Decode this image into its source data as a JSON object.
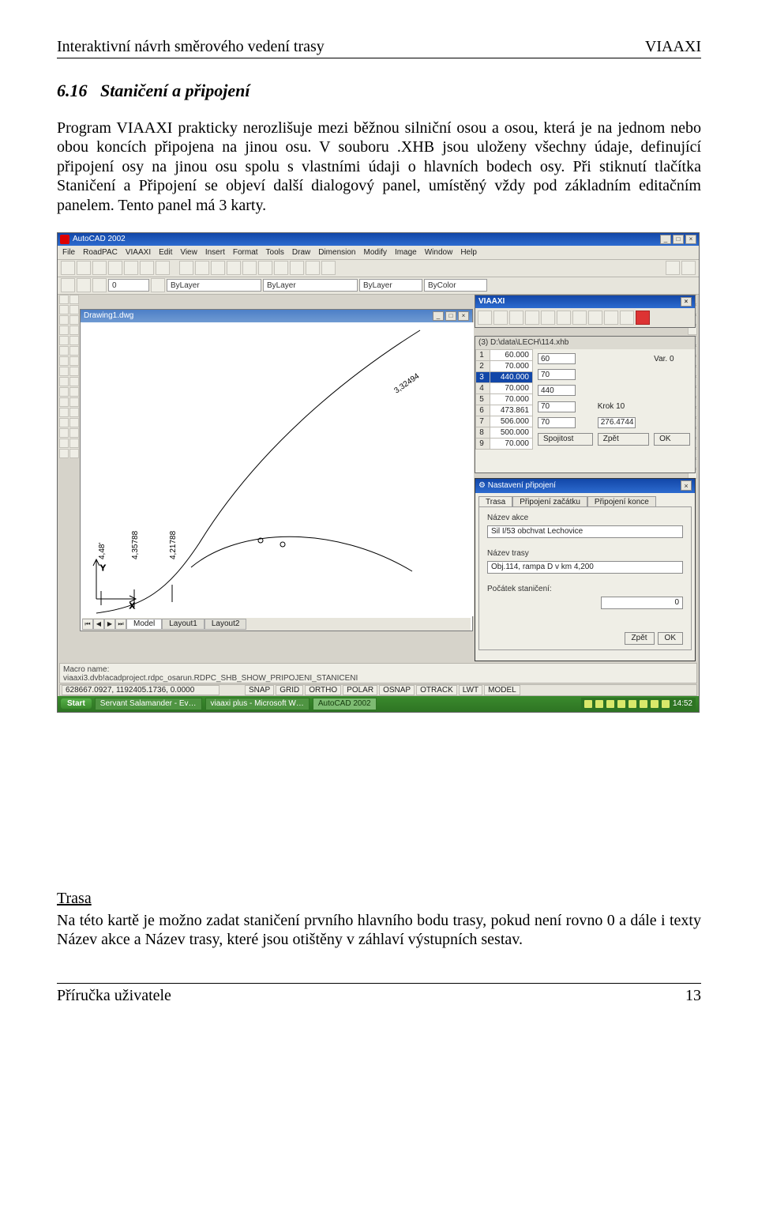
{
  "header": {
    "left": "Interaktivní návrh směrového vedení trasy",
    "right": "VIAAXI"
  },
  "section": {
    "num": "6.16",
    "title": "Staničení a připojení"
  },
  "para1": "Program VIAAXI prakticky nerozlišuje mezi běžnou silniční osou a osou, která je na jednom nebo obou koncích připojena na jinou osu. V souboru .XHB jsou uloženy všechny údaje, definující připojení osy na jinou osu spolu s vlastními údaji o hlavních bodech osy. Při stiknutí tlačítka Staničení a Připojení se objeví další dialogový panel, umístěný vždy pod základním editačním panelem. Tento panel má 3 karty.",
  "shot": {
    "app_title": "AutoCAD 2002",
    "menus": [
      "File",
      "RoadPAC",
      "VIAAXI",
      "Edit",
      "View",
      "Insert",
      "Format",
      "Tools",
      "Draw",
      "Dimension",
      "Modify",
      "Image",
      "Window",
      "Help"
    ],
    "layer_combo": "0",
    "bylayer": "ByLayer",
    "bycolor": "ByColor",
    "drawing_title": "Drawing1.dwg",
    "model_tabs": [
      "Model",
      "Layout1",
      "Layout2"
    ],
    "marks": {
      "a": "4,48'",
      "b": "4,35788",
      "c": "4,21788",
      "d": "3,32494"
    },
    "viaaxi_title": "VIAAXI",
    "axcard": {
      "title": "(3) D:\\data\\LECH\\114.xhb",
      "rows": [
        {
          "i": "1",
          "v": "60.000"
        },
        {
          "i": "2",
          "v": "70.000"
        },
        {
          "i": "3",
          "v": "440.000"
        },
        {
          "i": "4",
          "v": "70.000"
        },
        {
          "i": "5",
          "v": "70.000"
        },
        {
          "i": "6",
          "v": "473.861"
        },
        {
          "i": "7",
          "v": "506.000"
        },
        {
          "i": "8",
          "v": "500.000"
        },
        {
          "i": "9",
          "v": "70.000"
        }
      ],
      "r_fields": {
        "f1": "60",
        "f_var": "Var. 0",
        "f2": "70",
        "f3": "440",
        "f4": "70",
        "krok": "Krok 10",
        "f5": "70",
        "f6": "276.4744"
      },
      "r_btns": {
        "spoj": "Spojitost",
        "zp": "Zpět",
        "ok": "OK"
      }
    },
    "dialog": {
      "title": "Nastavení připojení",
      "tabs": [
        "Trasa",
        "Připojení začátku",
        "Připojení konce"
      ],
      "labels": {
        "akce": "Název akce",
        "trasa": "Název trasy",
        "poc": "Počátek staničení:"
      },
      "values": {
        "akce": "Sil I/53 obchvat Lechovice",
        "trasa": "Obj.114, rampa D v km 4,200",
        "poc": "0"
      },
      "btns": {
        "zp": "Zpět",
        "ok": "OK"
      }
    },
    "cmd": {
      "l1": "Macro name:",
      "l2": "viaaxi3.dvb!acadproject.rdpc_osarun.RDPC_SHB_SHOW_PRIPOJENI_STANICENI"
    },
    "status": {
      "coords": "628667.0927, 1192405.1736, 0.0000",
      "toggles": [
        "SNAP",
        "GRID",
        "ORTHO",
        "POLAR",
        "OSNAP",
        "OTRACK",
        "LWT",
        "MODEL"
      ]
    },
    "taskbar": {
      "start": "Start",
      "tasks": [
        "Servant Salamander - Ev…",
        "viaaxi plus - Microsoft W…",
        "AutoCAD 2002"
      ],
      "time": "14:52"
    }
  },
  "trasa": {
    "h": "Trasa",
    "t": "Na této kartě je možno zadat staničení prvního hlavního bodu trasy, pokud není rovno 0 a dále i texty Název akce a Název trasy, které jsou otištěny v záhlaví výstupních sestav."
  },
  "footer": {
    "left": "Příručka uživatele",
    "right": "13"
  }
}
